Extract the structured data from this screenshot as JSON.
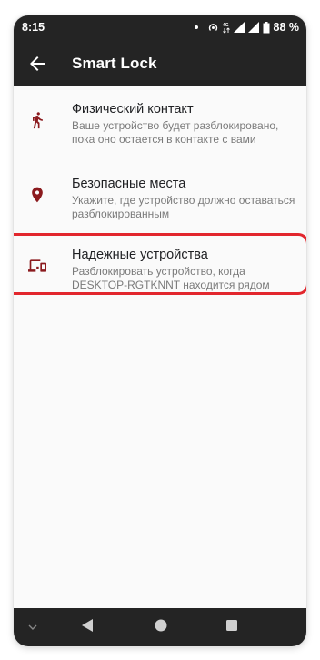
{
  "status_bar": {
    "time": "8:15",
    "battery": "88 %",
    "icons": [
      "notification-dot-icon",
      "hotspot-icon",
      "4g-icon",
      "signal-icon",
      "signal-icon",
      "battery-icon"
    ]
  },
  "toolbar": {
    "title": "Smart Lock",
    "back_icon": "arrow-left-icon"
  },
  "items": [
    {
      "icon": "person-walking-icon",
      "title": "Физический контакт",
      "subtitle": "Ваше устройство будет разблокировано, пока оно остается в контакте с вами"
    },
    {
      "icon": "location-pin-icon",
      "title": "Безопасные места",
      "subtitle": "Укажите, где устройство должно оставаться разблокированным"
    },
    {
      "icon": "devices-icon",
      "title": "Надежные устройства",
      "subtitle": "Разблокировать устройство, когда DESKTOP-RGTKNNT находится рядом"
    }
  ],
  "colors": {
    "bar_background": "#242424",
    "page_background": "#fafafa",
    "accent_icon": "#8b1a1e",
    "highlight": "#e2262d"
  },
  "nav_bar": [
    "chevron-down-icon",
    "back-triangle-icon",
    "home-circle-icon",
    "recents-square-icon"
  ]
}
